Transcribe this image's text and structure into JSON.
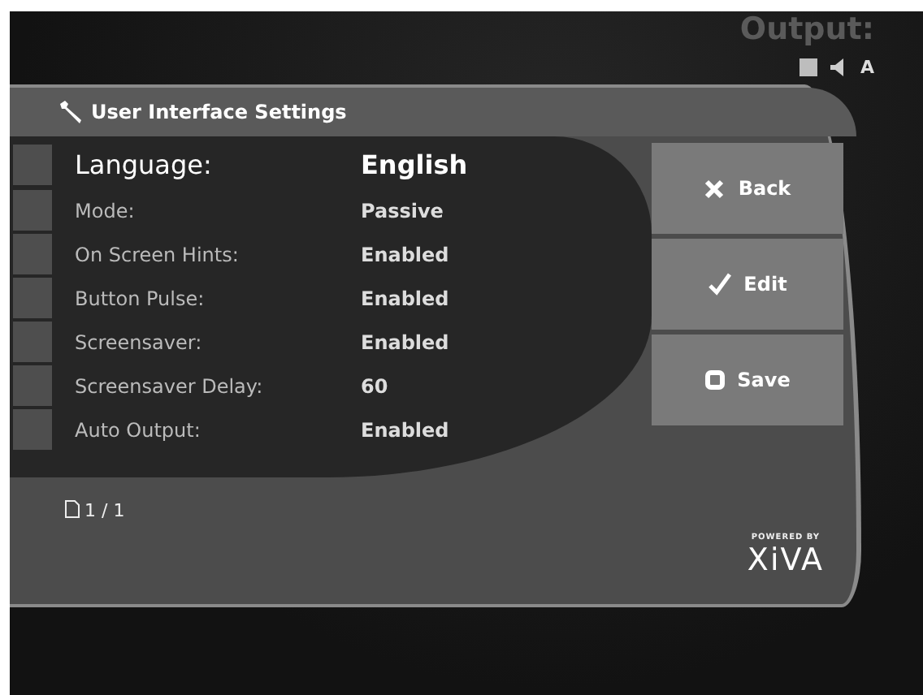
{
  "header": {
    "output_label": "Output:",
    "zone": "A"
  },
  "title": "User Interface Settings",
  "settings": [
    {
      "label": "Language:",
      "value": "English",
      "selected": true
    },
    {
      "label": "Mode:",
      "value": "Passive",
      "selected": false
    },
    {
      "label": "On Screen Hints:",
      "value": "Enabled",
      "selected": false
    },
    {
      "label": "Button Pulse:",
      "value": "Enabled",
      "selected": false
    },
    {
      "label": "Screensaver:",
      "value": "Enabled",
      "selected": false
    },
    {
      "label": "Screensaver Delay:",
      "value": "60",
      "selected": false
    },
    {
      "label": "Auto Output:",
      "value": "Enabled",
      "selected": false
    }
  ],
  "buttons": [
    {
      "kind": "back",
      "label": "Back"
    },
    {
      "kind": "edit",
      "label": "Edit"
    },
    {
      "kind": "save",
      "label": "Save"
    }
  ],
  "page": "1 / 1",
  "logo": {
    "tagline": "POWERED BY",
    "name": "XiVA"
  }
}
